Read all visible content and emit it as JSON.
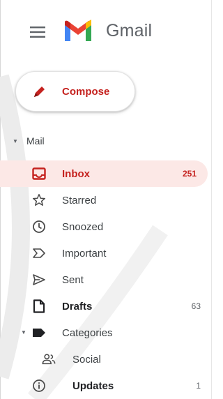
{
  "header": {
    "title": "Gmail",
    "menu_icon": "hamburger-menu-icon",
    "logo_icon": "gmail-m-logo",
    "brand_colors": {
      "red": "#ea4335",
      "blue": "#4285f4",
      "green": "#34a853",
      "yellow": "#fbbc04",
      "dark_red": "#c5221f"
    }
  },
  "compose": {
    "label": "Compose",
    "icon": "pencil-icon"
  },
  "mail_section": {
    "label": "Mail"
  },
  "nav": {
    "items": [
      {
        "label": "Inbox",
        "count": "251",
        "icon": "inbox-icon",
        "active": true
      },
      {
        "label": "Starred",
        "count": "",
        "icon": "star-icon"
      },
      {
        "label": "Snoozed",
        "count": "",
        "icon": "clock-icon"
      },
      {
        "label": "Important",
        "count": "",
        "icon": "important-icon"
      },
      {
        "label": "Sent",
        "count": "",
        "icon": "send-icon"
      },
      {
        "label": "Drafts",
        "count": "63",
        "icon": "draft-icon",
        "bold": true
      },
      {
        "label": "Categories",
        "count": "",
        "icon": "label-icon"
      },
      {
        "label": "Social",
        "count": "",
        "icon": "people-icon"
      },
      {
        "label": "Updates",
        "count": "1",
        "icon": "info-icon",
        "bold": true
      }
    ]
  }
}
